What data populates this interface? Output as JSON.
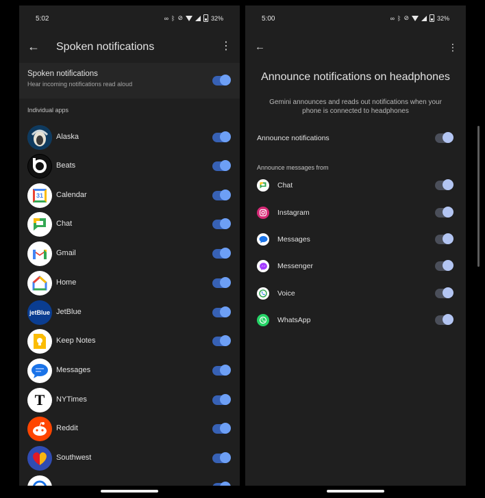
{
  "left": {
    "status": {
      "time": "5:02",
      "battery": "32%"
    },
    "header": {
      "title": "Spoken notifications"
    },
    "master": {
      "title": "Spoken notifications",
      "subtitle": "Hear incoming notifications read aloud",
      "enabled": true
    },
    "section_label": "Individual apps",
    "apps": [
      {
        "label": "Alaska",
        "icon": "alaska-icon",
        "enabled": true
      },
      {
        "label": "Beats",
        "icon": "beats-icon",
        "enabled": true
      },
      {
        "label": "Calendar",
        "icon": "calendar-icon",
        "enabled": true
      },
      {
        "label": "Chat",
        "icon": "chat-icon",
        "enabled": true
      },
      {
        "label": "Gmail",
        "icon": "gmail-icon",
        "enabled": true
      },
      {
        "label": "Home",
        "icon": "home-icon",
        "enabled": true
      },
      {
        "label": "JetBlue",
        "icon": "jetblue-icon",
        "enabled": true
      },
      {
        "label": "Keep Notes",
        "icon": "keep-notes-icon",
        "enabled": true
      },
      {
        "label": "Messages",
        "icon": "messages-icon",
        "enabled": true
      },
      {
        "label": "NYTimes",
        "icon": "nytimes-icon",
        "enabled": true
      },
      {
        "label": "Reddit",
        "icon": "reddit-icon",
        "enabled": true
      },
      {
        "label": "Southwest",
        "icon": "southwest-icon",
        "enabled": true
      }
    ],
    "icon_glyphs": {
      "calendar": "31",
      "jetblue": "jetBlue",
      "nytimes": "T",
      "beats": "b"
    }
  },
  "right": {
    "status": {
      "time": "5:00",
      "battery": "32%"
    },
    "headline": "Announce notifications on headphones",
    "description": "Gemini announces and reads out notifications when your phone is connected to headphones",
    "announce": {
      "label": "Announce notifications",
      "enabled": true
    },
    "section_label": "Announce messages from",
    "apps": [
      {
        "label": "Chat",
        "icon": "chat-icon",
        "enabled": true
      },
      {
        "label": "Instagram",
        "icon": "instagram-icon",
        "enabled": true
      },
      {
        "label": "Messages",
        "icon": "messages-icon",
        "enabled": true
      },
      {
        "label": "Messenger",
        "icon": "messenger-icon",
        "enabled": true
      },
      {
        "label": "Voice",
        "icon": "voice-icon",
        "enabled": true
      },
      {
        "label": "WhatsApp",
        "icon": "whatsapp-icon",
        "enabled": true
      }
    ]
  },
  "colors": {
    "background": "#1f1f1f",
    "toggle_blue_track": "#3761b5",
    "toggle_blue_knob": "#6d9ff5",
    "toggle_gray_track": "#4b4f5a",
    "toggle_gray_knob": "#b3c5f2"
  }
}
